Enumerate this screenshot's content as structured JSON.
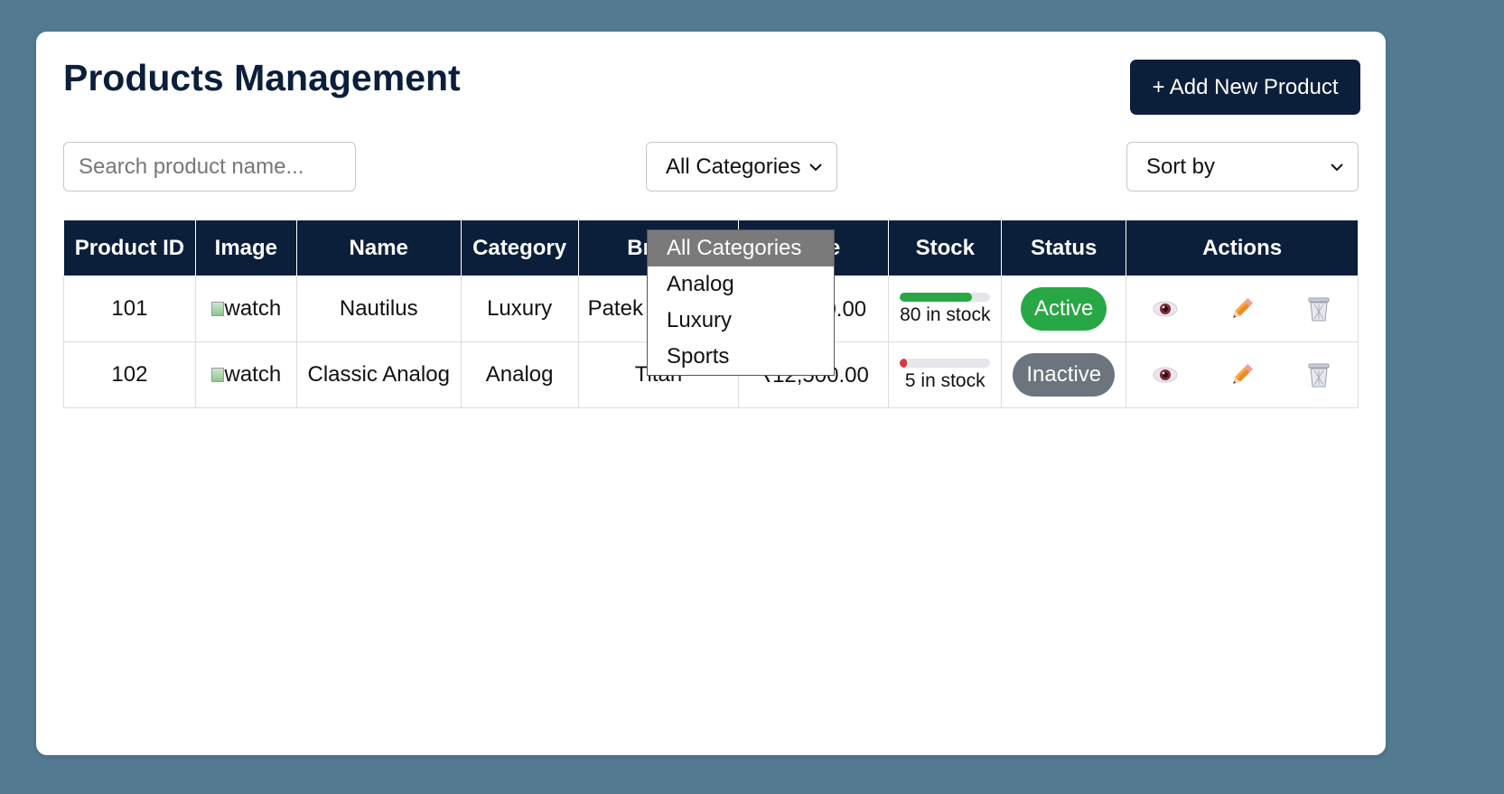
{
  "page": {
    "title": "Products Management",
    "add_button": "+ Add New Product"
  },
  "filters": {
    "search_placeholder": "Search product name...",
    "category_select": "All Categories",
    "sort_select": "Sort by",
    "category_options": [
      "All Categories",
      "Analog",
      "Luxury",
      "Sports"
    ],
    "highlighted_option": "All Categories"
  },
  "table": {
    "headers": [
      "Product ID",
      "Image",
      "Name",
      "Category",
      "Brand",
      "Price",
      "Stock",
      "Status",
      "Actions"
    ],
    "rows": [
      {
        "id": "101",
        "image_alt": "watch",
        "name": "Nautilus",
        "category": "Luxury",
        "brand": "Patek",
        "price": "₹xx,xx0.00",
        "stock_text": "80 in stock",
        "stock_level": 0.8,
        "stock_color": "#28a745",
        "status": "Active",
        "status_color": "#28a745"
      },
      {
        "id": "102",
        "image_alt": "watch",
        "name": "Classic Analog",
        "category": "Analog",
        "brand": "Titan",
        "price": "₹12,500.00",
        "stock_text": "5 in stock",
        "stock_level": 0.05,
        "stock_color": "#dc3545",
        "status": "Inactive",
        "status_color": "#6c757d"
      }
    ],
    "action_icons": [
      "view-icon",
      "edit-icon",
      "delete-icon"
    ]
  },
  "colors": {
    "primary": "#0b1f3b",
    "background": "#537a91",
    "active": "#28a745",
    "inactive": "#6c757d",
    "low_stock": "#dc3545"
  }
}
